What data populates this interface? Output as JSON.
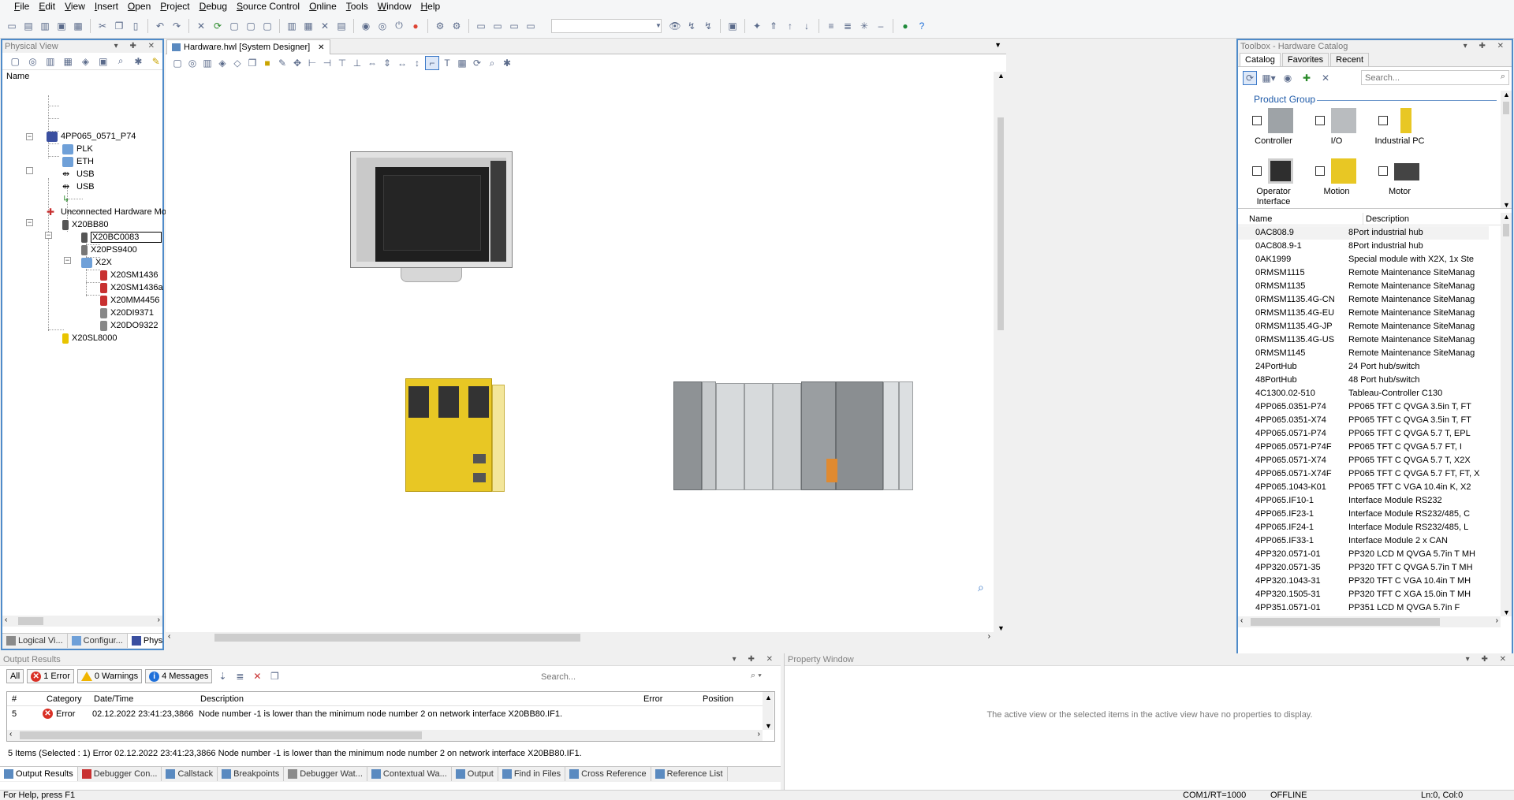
{
  "menu": [
    "File",
    "Edit",
    "View",
    "Insert",
    "Open",
    "Project",
    "Debug",
    "Source Control",
    "Online",
    "Tools",
    "Window",
    "Help"
  ],
  "physical_view": {
    "title": "Physical View",
    "column_header": "Name",
    "tree": {
      "root": "4PP065_0571_P74",
      "root_children": [
        "PLK",
        "ETH",
        "USB",
        "USB"
      ],
      "unconnected": "Unconnected Hardware Modules",
      "bus_controller": "X20BB80",
      "bc_children": [
        "X20BC0083",
        "X20PS9400"
      ],
      "x2x": "X2X",
      "x2x_children": [
        "X20SM1436",
        "X20SM1436a",
        "X20MM4456",
        "X20DI9371",
        "X20DO9322"
      ],
      "safe_logic": "X20SL8000"
    },
    "tabs": [
      "Logical Vi...",
      "Configur...",
      "Physical V..."
    ]
  },
  "designer": {
    "tab_label": "Hardware.hwl [System Designer]"
  },
  "toolbox": {
    "title": "Toolbox - Hardware Catalog",
    "tabs": [
      "Catalog",
      "Favorites",
      "Recent"
    ],
    "search_placeholder": "Search...",
    "product_group_label": "Product Group",
    "product_groups": [
      {
        "label": "Controller",
        "icon": "controller-icon"
      },
      {
        "label": "I/O",
        "icon": "io-module-icon"
      },
      {
        "label": "Industrial PC",
        "icon": "industrial-pc-icon"
      },
      {
        "label": "Operator Interface",
        "icon": "operator-interface-icon"
      },
      {
        "label": "Motion",
        "icon": "motion-icon"
      },
      {
        "label": "Motor",
        "icon": "motor-icon"
      }
    ],
    "columns": [
      "Name",
      "Description"
    ],
    "rows": [
      [
        "0AC808.9",
        "8Port industrial hub"
      ],
      [
        "0AC808.9-1",
        "8Port industrial hub"
      ],
      [
        "0AK1999",
        "Special module with X2X, 1x Ste"
      ],
      [
        "0RMSM1115",
        "Remote Maintenance SiteManag"
      ],
      [
        "0RMSM1135",
        "Remote Maintenance SiteManag"
      ],
      [
        "0RMSM1135.4G-CN",
        "Remote Maintenance SiteManag"
      ],
      [
        "0RMSM1135.4G-EU",
        "Remote Maintenance SiteManag"
      ],
      [
        "0RMSM1135.4G-JP",
        "Remote Maintenance SiteManag"
      ],
      [
        "0RMSM1135.4G-US",
        "Remote Maintenance SiteManag"
      ],
      [
        "0RMSM1145",
        "Remote Maintenance SiteManag"
      ],
      [
        "24PortHub",
        "24 Port hub/switch"
      ],
      [
        "48PortHub",
        "48 Port hub/switch"
      ],
      [
        "4C1300.02-510",
        "Tableau-Controller C130"
      ],
      [
        "4PP065.0351-P74",
        "PP065 TFT C QVGA 3.5in T, FT"
      ],
      [
        "4PP065.0351-X74",
        "PP065 TFT C QVGA 3.5in T, FT"
      ],
      [
        "4PP065.0571-P74",
        "PP065 TFT C QVGA 5.7 T, EPL"
      ],
      [
        "4PP065.0571-P74F",
        "PP065 TFT C QVGA 5.7 FT, I"
      ],
      [
        "4PP065.0571-X74",
        "PP065 TFT C QVGA 5.7 T, X2X"
      ],
      [
        "4PP065.0571-X74F",
        "PP065 TFT C QVGA 5.7 FT, FT, X"
      ],
      [
        "4PP065.1043-K01",
        "PP065 TFT C VGA 10.4in K, X2"
      ],
      [
        "4PP065.IF10-1",
        "Interface Module RS232"
      ],
      [
        "4PP065.IF23-1",
        "Interface Module RS232/485, C"
      ],
      [
        "4PP065.IF24-1",
        "Interface Module RS232/485, L"
      ],
      [
        "4PP065.IF33-1",
        "Interface Module 2 x CAN"
      ],
      [
        "4PP320.0571-01",
        "PP320 LCD M QVGA 5.7in T MH"
      ],
      [
        "4PP320.0571-35",
        "PP320 TFT C QVGA 5.7in T MH"
      ],
      [
        "4PP320.1043-31",
        "PP320 TFT C VGA 10.4in T MH"
      ],
      [
        "4PP320.1505-31",
        "PP320 TFT C XGA 15.0in T MH"
      ],
      [
        "4PP351.0571-01",
        "PP351 LCD M QVGA 5.7in F"
      ]
    ]
  },
  "output": {
    "title": "Output Results",
    "filter_all": "All",
    "filter_errors": "1 Error",
    "filter_warnings": "0 Warnings",
    "filter_messages": "4 Messages",
    "search_placeholder": "Search...",
    "columns": [
      "#",
      "Category",
      "Date/Time",
      "Description",
      "Error",
      "Position"
    ],
    "row": {
      "num": "5",
      "category": "Error",
      "datetime": "02.12.2022 23:41:23,3866",
      "description": "Node number -1 is lower than the minimum node number 2 on network interface X20BB80.IF1.",
      "error": "",
      "position": ""
    },
    "summary": "5 Items (Selected : 1) Error 02.12.2022 23:41:23,3866 Node number -1 is lower than the minimum node number 2 on network interface X20BB80.IF1."
  },
  "bottom_tabs": [
    "Output Results",
    "Debugger Con...",
    "Callstack",
    "Breakpoints",
    "Debugger Wat...",
    "Contextual Wa...",
    "Output",
    "Find in Files",
    "Cross Reference",
    "Reference List"
  ],
  "property_window": {
    "title": "Property Window",
    "message": "The active view or the selected items in the active view have no properties to display."
  },
  "statusbar": {
    "help": "For Help, press F1",
    "connection": "COM1/RT=1000",
    "mode": "OFFLINE",
    "position": "Ln:0, Col:0"
  }
}
